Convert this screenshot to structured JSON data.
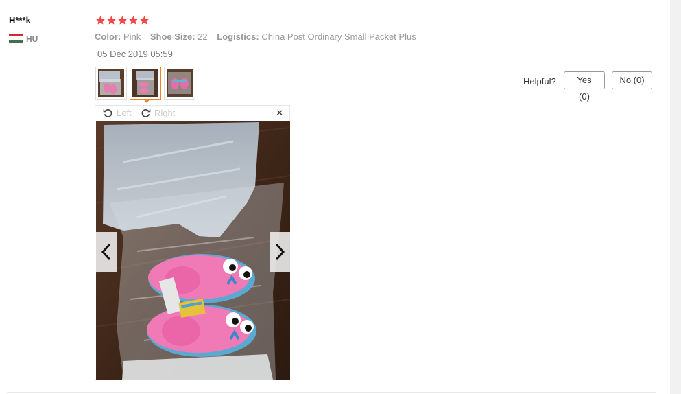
{
  "review": {
    "user_name": "H***k",
    "country_code": "HU",
    "flag_colors": [
      "#cd2a3e",
      "#ffffff",
      "#436f4d"
    ],
    "rating": 5,
    "rating_max": 5,
    "star_color": "#f44747",
    "attributes": [
      {
        "label": "Color:",
        "value": "Pink"
      },
      {
        "label": "Shoe Size:",
        "value": "22"
      },
      {
        "label": "Logistics:",
        "value": "China Post Ordinary Small Packet Plus"
      }
    ],
    "date": "05 Dec 2019 05:59",
    "thumbnails_count": 3,
    "active_thumbnail": 2
  },
  "helpful": {
    "label": "Helpful?",
    "yes_label": "Yes (0)",
    "no_label": "No (0)"
  },
  "viewer": {
    "rotate_left_label": "Left",
    "rotate_right_label": "Right",
    "close_glyph": "×",
    "icons": [
      "rotate-left-icon",
      "rotate-right-icon",
      "close-icon",
      "chevron-left-icon",
      "chevron-right-icon"
    ]
  },
  "colors": {
    "accent_orange": "#f58220",
    "muted_text": "#999999"
  }
}
